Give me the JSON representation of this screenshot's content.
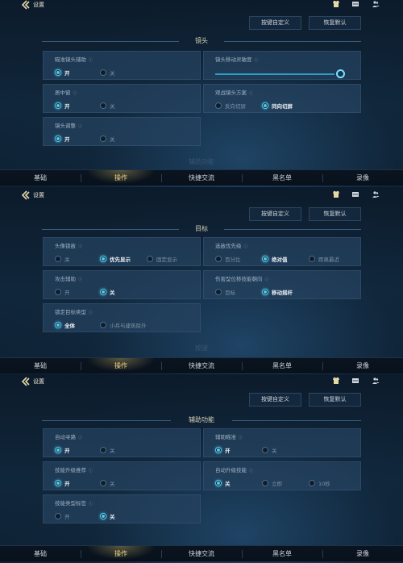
{
  "panels": [
    {
      "title": "设置",
      "buttons": {
        "custom_keys": "按键自定义",
        "restore_default": "恢复默认"
      },
      "section_title": "镜头",
      "settings": [
        {
          "label": "瞄准镜头辅助",
          "options": [
            "开",
            "关"
          ],
          "selected": "开"
        },
        {
          "label": "镜头移动灵敏度",
          "slider_value": 1.0
        },
        {
          "label": "居中窗",
          "options": [
            "开",
            "关"
          ],
          "selected": "开"
        },
        {
          "label": "观战镜头方案",
          "options": [
            "反向切屏",
            "同向切屏"
          ],
          "selected": "同向切屏"
        },
        {
          "label": "镜头调整",
          "options": [
            "开",
            "关"
          ],
          "selected": "开"
        }
      ],
      "next_section_hint": "辅助功能"
    },
    {
      "title": "设置",
      "buttons": {
        "custom_keys": "按键自定义",
        "restore_default": "恢复默认"
      },
      "section_title": "目标",
      "settings": [
        {
          "label": "头像锁敌",
          "options": [
            "关",
            "优先显示",
            "固定显示"
          ],
          "selected": "优先显示"
        },
        {
          "label": "选敌优先级",
          "options": [
            "百分比",
            "绝对值",
            "距离最近"
          ],
          "selected": "绝对值"
        },
        {
          "label": "攻击辅助",
          "options": [
            "开",
            "关"
          ],
          "selected": "关"
        },
        {
          "label": "伤害型位移技能朝向",
          "options": [
            "目标",
            "移动摇杆"
          ],
          "selected": "移动摇杆"
        },
        {
          "label": "锁定目标类型",
          "options": [
            "全体",
            "小兵与建筑除外"
          ],
          "selected": "全体"
        }
      ],
      "next_section_hint": "按键"
    },
    {
      "title": "设置",
      "buttons": {
        "custom_keys": "按键自定义",
        "restore_default": "恢复默认"
      },
      "section_title": "辅助功能",
      "settings": [
        {
          "label": "自动寻路",
          "options": [
            "开",
            "关"
          ],
          "selected": "开"
        },
        {
          "label": "辅助瞄准",
          "options": [
            "开",
            "关"
          ],
          "selected": "开"
        },
        {
          "label": "技能升级推荐",
          "options": [
            "开",
            "关"
          ],
          "selected": "开"
        },
        {
          "label": "自动升级技能",
          "options": [
            "关",
            "立即",
            "10秒"
          ],
          "selected": "关"
        },
        {
          "label": "技能类型标签",
          "options": [
            "开",
            "关"
          ],
          "selected": "关"
        }
      ]
    }
  ],
  "tabs": [
    "基础",
    "操作",
    "快捷交流",
    "黑名单",
    "录像"
  ],
  "active_tab": "操作",
  "icons": [
    "back-arrow-icon",
    "shirt-icon",
    "chat-icon",
    "friends-icon",
    "info-icon"
  ],
  "colors": {
    "accent": "#56c8e8",
    "gold": "#f0d98a",
    "card": "#26425f",
    "bg": "#0c1b2b"
  }
}
